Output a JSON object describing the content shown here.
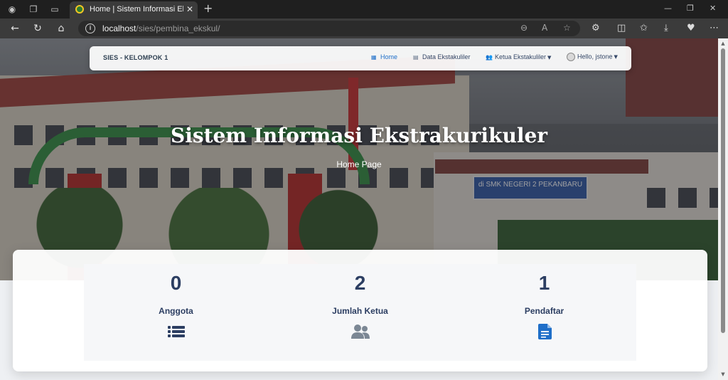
{
  "browser": {
    "tab_title": "Home | Sistem Informasi Ekstrakurikuler",
    "url_host": "localhost",
    "url_path": "/sies/pembina_ekskul/"
  },
  "navbar": {
    "brand": "SIES - KELOMPOK 1",
    "items": [
      {
        "label": "Home",
        "icon": "dashboard-icon",
        "active": true
      },
      {
        "label": "Data Ekstakuliler",
        "icon": "file-icon"
      },
      {
        "label": "Ketua Ekstakuliler",
        "icon": "users-icon",
        "dropdown": true
      },
      {
        "label": "Hello, jstone",
        "icon": "avatar",
        "dropdown": true
      }
    ]
  },
  "hero": {
    "title": "Sistem Informasi Ekstrakurikuler",
    "subtitle": "Home Page",
    "banner_text": "di SMK NEGERI 2 PEKANBARU"
  },
  "stats": [
    {
      "value": "0",
      "label": "Anggota",
      "icon": "list-icon",
      "color": "#2c3e62"
    },
    {
      "value": "2",
      "label": "Jumlah Ketua",
      "icon": "users-icon",
      "color": "#7b8794"
    },
    {
      "value": "1",
      "label": "Pendaftar",
      "icon": "document-icon",
      "color": "#1e6ec8"
    }
  ]
}
